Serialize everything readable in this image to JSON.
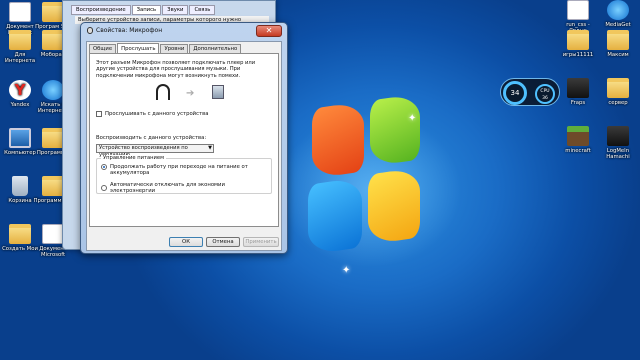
{
  "desktop": {
    "left_icons": [
      {
        "label": "Документ Microsoft",
        "icon": "doc-icon"
      },
      {
        "label": "Програм Spu от",
        "icon": "folder-icon"
      },
      {
        "label": "Для Интернета",
        "icon": "folder-icon"
      },
      {
        "label": "Моборан",
        "icon": "folder-icon"
      },
      {
        "label": "Yandex",
        "icon": "yandex-icon"
      },
      {
        "label": "Искать в Интернете",
        "icon": "ie-icon"
      },
      {
        "label": "Компьютер",
        "icon": "computer-icon"
      },
      {
        "label": "Программы",
        "icon": "folder-icon"
      },
      {
        "label": "Корзина",
        "icon": "recycle-bin-icon"
      },
      {
        "label": "Программы ...",
        "icon": "folder-icon"
      },
      {
        "label": "Создать Мои",
        "icon": "folder-icon"
      },
      {
        "label": "Документ Microsoft",
        "icon": "doc-icon"
      }
    ],
    "right_icons": [
      {
        "label": "run_css - Ярлык",
        "icon": "shortcut-icon"
      },
      {
        "label": "MediaGet",
        "icon": "mediaget-icon"
      },
      {
        "label": "игры11111",
        "icon": "folder-icon"
      },
      {
        "label": "Максим",
        "icon": "folder-icon"
      },
      {
        "label": "Fraps",
        "icon": "fraps-icon"
      },
      {
        "label": "сервер",
        "icon": "folder-icon"
      },
      {
        "label": "minecraft",
        "icon": "minecraft-icon"
      },
      {
        "label": "LogMeIn Hamachi",
        "icon": "hamachi-icon"
      }
    ],
    "gadget": {
      "cpu_percent": "34",
      "label": "CPU",
      "second_value": "36"
    }
  },
  "background_window": {
    "tabs": [
      "Воспроизведение",
      "Запись",
      "Звуки",
      "Связь"
    ],
    "selected_tab": 1,
    "hint": "Выберите устройство записи, параметры которого нужно"
  },
  "dialog": {
    "title": "Свойства: Микрофон",
    "close": "✕",
    "tabs": [
      "Общие",
      "Прослушать",
      "Уровни",
      "Дополнительно"
    ],
    "selected_tab": 1,
    "description": "Этот разъем Микрофон позволяет подключать плеер или другие устройства для прослушивания музыки. При подключении микрофона могут возникнуть помехи.",
    "listen_checkbox": {
      "label": "Прослушивать с данного устройства",
      "checked": false
    },
    "playback_label": "Воспроизводить с данного устройства:",
    "playback_select": "Устройство воспроизведения по умолчанию",
    "power": {
      "group_label": "Управление питанием",
      "option1": "Продолжать работу при переходе на питание от аккумулятора",
      "option2": "Автоматически отключать для экономии электроэнергии",
      "selected": 1
    },
    "buttons": {
      "ok": "ОК",
      "cancel": "Отмена",
      "apply": "Применить"
    }
  }
}
